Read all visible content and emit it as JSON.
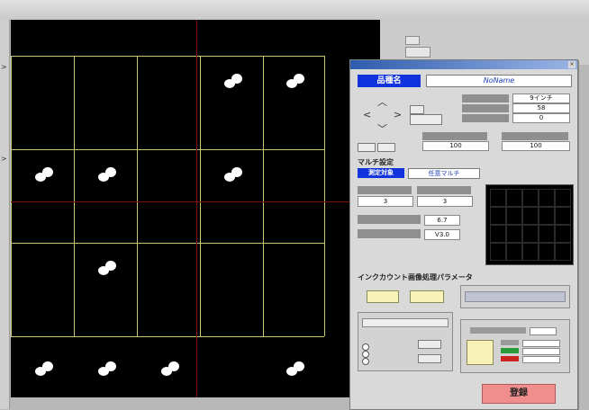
{
  "window": {
    "title": "",
    "dialog_title": "",
    "menu": [
      "",
      "",
      "",
      ""
    ]
  },
  "view": {
    "cols": 6,
    "rows": 4,
    "dots": [
      {
        "cell": [
          3,
          0
        ]
      },
      {
        "cell": [
          4,
          0
        ]
      },
      {
        "cell": [
          0,
          1
        ]
      },
      {
        "cell": [
          1,
          1
        ]
      },
      {
        "cell": [
          3,
          1
        ]
      },
      {
        "cell": [
          1,
          2
        ]
      },
      {
        "cell": [
          0,
          3
        ]
      },
      {
        "cell": [
          1,
          3
        ]
      },
      {
        "cell": [
          2,
          3
        ]
      },
      {
        "cell": [
          4,
          3
        ]
      }
    ]
  },
  "dialog": {
    "product_label": "品種名",
    "product_value": "NoName",
    "param1_label": "",
    "param1_value": "9インチ",
    "param2_label": "",
    "param2_value": "58",
    "param3_label": "",
    "param3_value": "0",
    "offset_x_label": "",
    "offset_x_value": "100",
    "offset_y_label": "",
    "offset_y_value": "100",
    "move_label": "",
    "origin_label": "",
    "multi_section": "マルチ設定",
    "multi_mode_label": "測定対象",
    "multi_mode_value": "任意マルチ",
    "count_x_label": "",
    "count_x_value": "3",
    "count_y_label": "",
    "count_y_value": "3",
    "pitch_x_label": "",
    "pitch_x_value": "6.7",
    "pitch_y_label": "",
    "pitch_y_value": "V3.0",
    "inkcount_section": "インクカウント画像処理パラメータ",
    "ink_btn1": "",
    "ink_btn2": "",
    "register_label": "登録"
  },
  "colors": {
    "accent_blue": "#1133dd",
    "register_red": "#f08d8d",
    "grid_yellow": "#c8c870"
  }
}
